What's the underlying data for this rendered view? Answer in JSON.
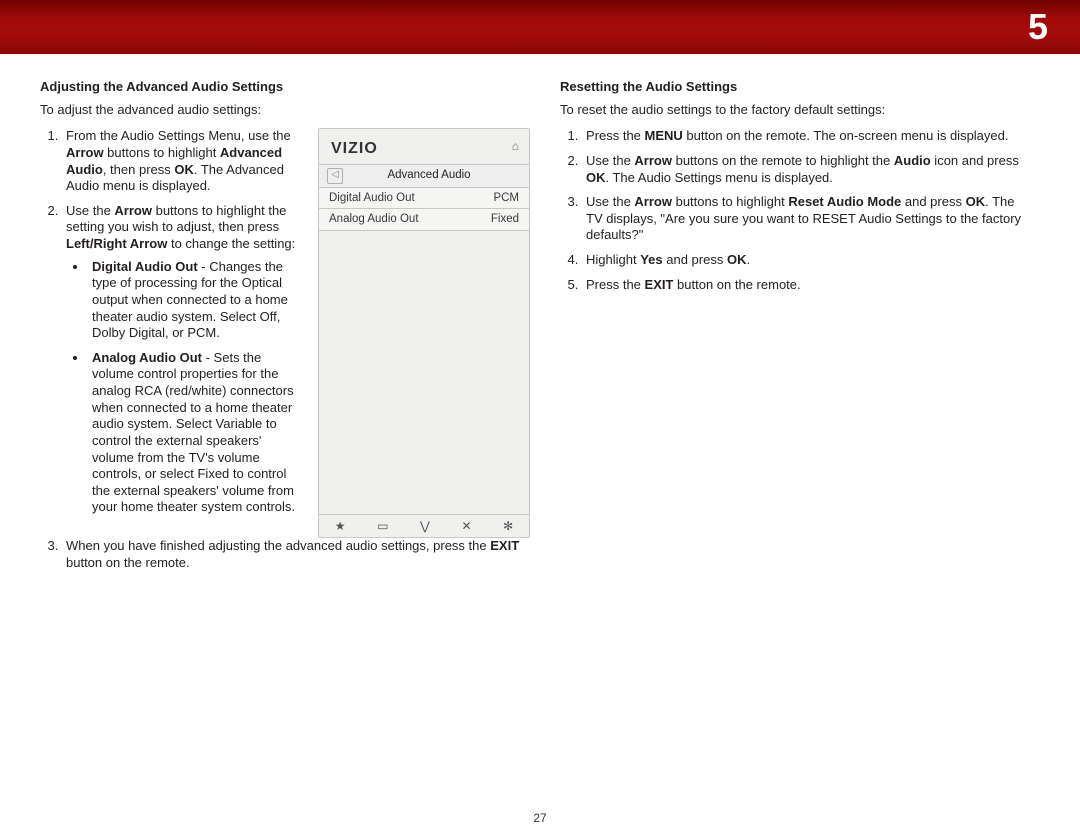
{
  "banner": {
    "chapter": "5"
  },
  "left": {
    "heading": "Adjusting the Advanced Audio Settings",
    "intro": "To adjust the advanced audio settings:",
    "step1": {
      "a": "From the Audio Settings Menu, use the ",
      "b": "Arrow",
      "c": " buttons to highlight ",
      "d": "Advanced Audio",
      "e": ", then press ",
      "f": "OK",
      "g": ". The Advanced Audio menu is displayed."
    },
    "step2": {
      "a": "Use the ",
      "b": "Arrow",
      "c": " buttons to highlight the setting you wish to adjust, then press ",
      "d": "Left/Right Arrow",
      "e": " to change the setting:"
    },
    "bullet1": {
      "title": "Digital Audio Out",
      "body": " - Changes the type of processing for the Optical output when connected to a home theater audio system. Select Off, Dolby Digital, or PCM."
    },
    "bullet2": {
      "title": "Analog Audio Out",
      "body": " - Sets the volume control properties for the analog RCA (red/white) connectors when connected to a home theater audio system. Select Variable to control the external speakers' volume from the TV's volume controls, or select Fixed to control the external speakers' volume from your home theater system controls."
    },
    "step3": {
      "a": "When you have finished adjusting the advanced audio settings, press the ",
      "b": "EXIT",
      "c": " button on the remote."
    }
  },
  "right": {
    "heading": "Resetting the Audio Settings",
    "intro": "To reset the audio settings to the factory default settings:",
    "step1": {
      "a": "Press the ",
      "b": "MENU",
      "c": " button on the remote. The on-screen menu is displayed."
    },
    "step2": {
      "a": "Use the ",
      "b": "Arrow",
      "c": " buttons on the remote to highlight the ",
      "d": "Audio",
      "e": " icon and press ",
      "f": "OK",
      "g": ". The Audio Settings menu is displayed."
    },
    "step3": {
      "a": "Use the ",
      "b": "Arrow",
      "c": " buttons to highlight ",
      "d": "Reset Audio Mode",
      "e": " and press ",
      "f": "OK",
      "g": ". The TV displays, \"Are you sure you want to RESET Audio Settings to the factory defaults?\""
    },
    "step4": {
      "a": "Highlight ",
      "b": "Yes",
      "c": " and press ",
      "d": "OK",
      "e": "."
    },
    "step5": {
      "a": "Press the ",
      "b": "EXIT",
      "c": " button on the remote."
    }
  },
  "phone": {
    "brand": "VIZIO",
    "menuTitle": "Advanced Audio",
    "rows": [
      {
        "label": "Digital Audio Out",
        "value": "PCM"
      },
      {
        "label": "Analog Audio Out",
        "value": "Fixed"
      }
    ],
    "toolbar": [
      "★",
      "▭",
      "⋁",
      "✕",
      "✻"
    ]
  },
  "pageNumber": "27"
}
